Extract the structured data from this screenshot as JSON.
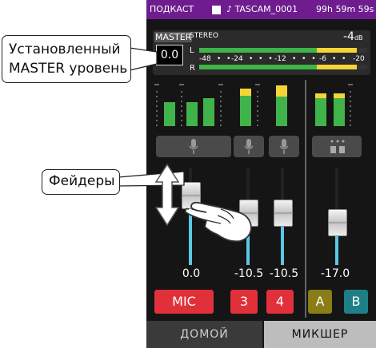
{
  "topbar": {
    "mode": "ПОДКАСТ",
    "file": "♪ TASCAM_0001",
    "remaining": "99h 59m 59s",
    "accent": "#6f1d8e"
  },
  "callouts": {
    "master": "Установленный MASTER уровень",
    "faders": "Фейдеры"
  },
  "master": {
    "label": "MASTER",
    "value": "0.0",
    "stereo_label": "STEREO",
    "peak": "-4",
    "peak_unit": "dB",
    "channel_l": "L",
    "channel_r": "R",
    "scale": [
      "-48",
      "-24",
      "-12",
      "-6",
      "-20"
    ],
    "meter_l_fraction": 0.7,
    "meter_r_fraction": 0.7
  },
  "channels": [
    {
      "name": "MIC",
      "value": "0.0",
      "color": "#e0313b",
      "icon": "microphone-icon"
    },
    {
      "name": "3",
      "value": "-10.5",
      "color": "#e0313b",
      "icon": "microphone-icon"
    },
    {
      "name": "4",
      "value": "-10.5",
      "color": "#e0313b",
      "icon": "microphone-icon"
    },
    {
      "name": "A",
      "value": "-17.0",
      "color": "#8a7c16",
      "icon": "stereo-input-icon"
    },
    {
      "name": "B",
      "value": "",
      "color": "#1f7f86",
      "icon": "stereo-input-icon"
    }
  ],
  "tabs": {
    "home": "ДОМОЙ",
    "mixer": "МИКШЕР"
  }
}
